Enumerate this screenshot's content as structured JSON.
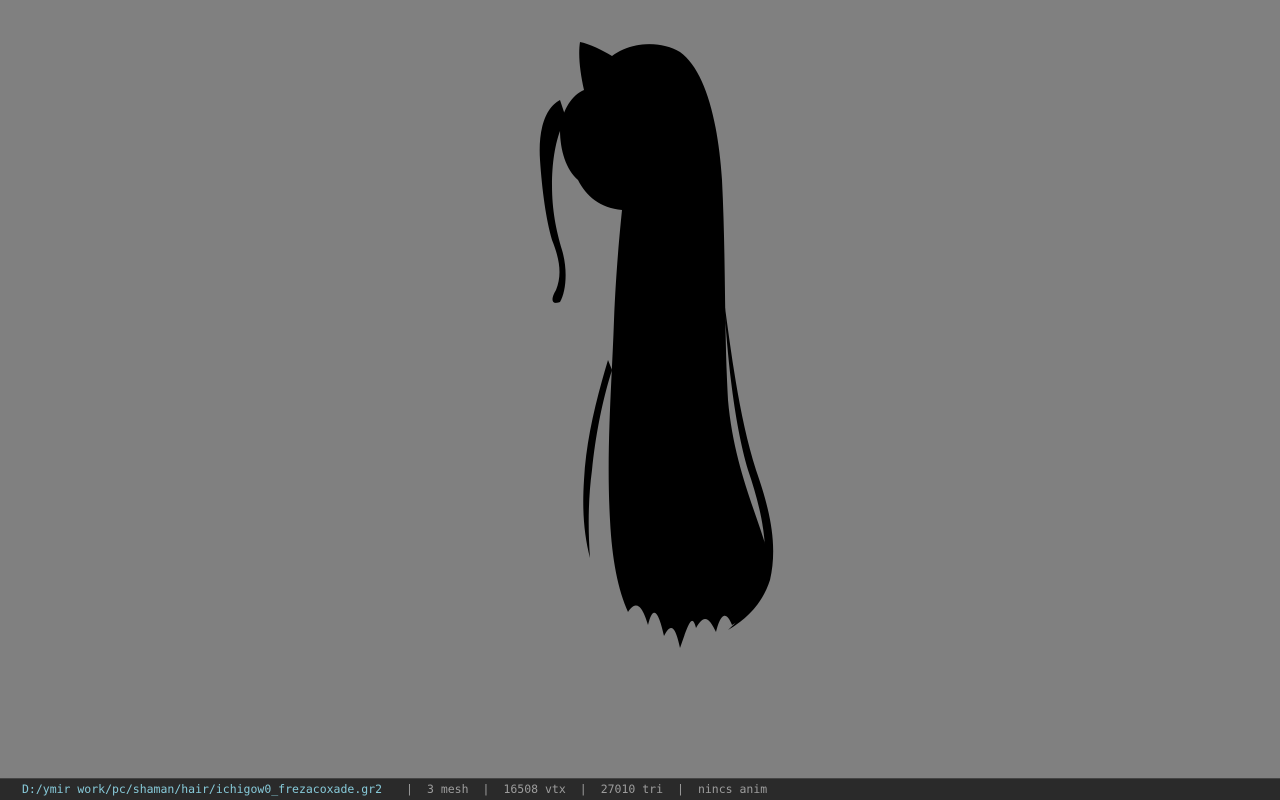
{
  "viewport": {
    "background_color": "#808080",
    "model_color": "#000000",
    "model_icon": "hair-mesh-silhouette"
  },
  "status": {
    "path": "D:/ymir work/pc/shaman/hair/ichigow0_frezacoxade.gr2",
    "mesh": "3 mesh",
    "vtx": "16508 vtx",
    "tri": "27010 tri",
    "anim": "nincs anim",
    "separator": "|"
  }
}
